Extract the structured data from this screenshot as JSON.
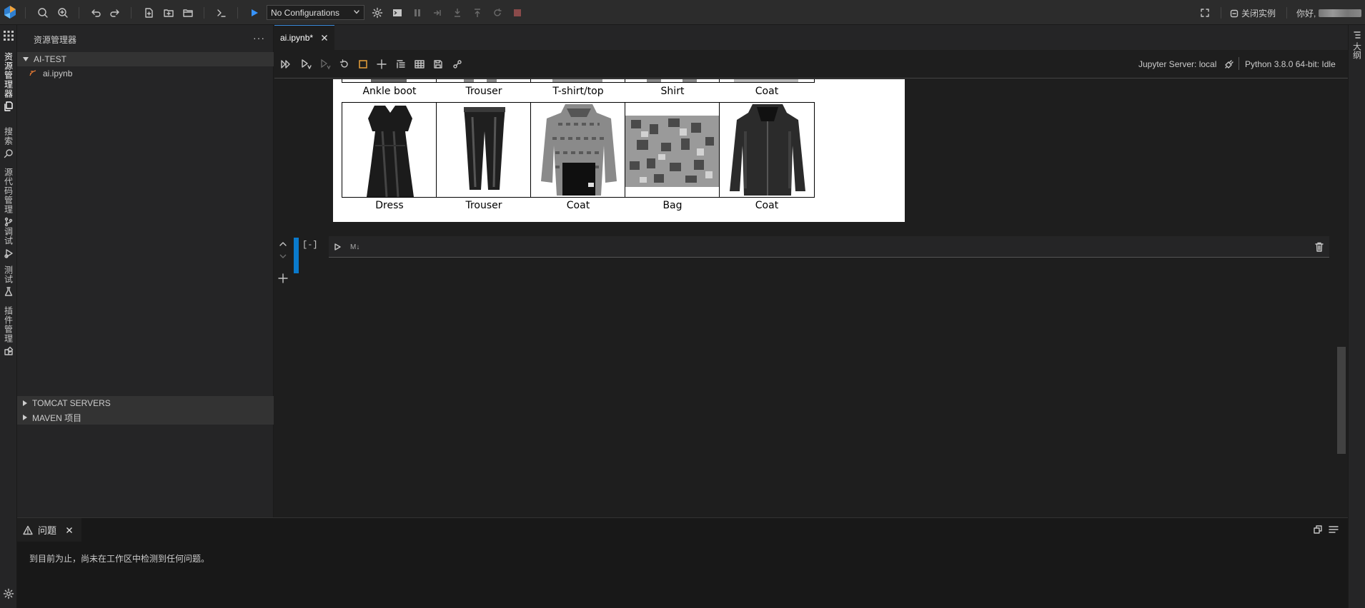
{
  "topbar": {
    "config_label": "No Configurations",
    "close_instance_label": "关闭实例",
    "greeting": "你好,"
  },
  "activity": {
    "explorer": "资源管理器",
    "search": "搜索",
    "source_control": "源代码管理",
    "debug": "调试",
    "test": "测试",
    "extensions": "插件管理"
  },
  "right_strip": {
    "outline": "大纲"
  },
  "sidebar": {
    "title": "资源管理器",
    "more": "···",
    "folder": "AI-TEST",
    "file": "ai.ipynb",
    "tomcat": "TOMCAT SERVERS",
    "maven": "MAVEN 项目"
  },
  "editor": {
    "tab_label": "ai.ipynb*",
    "jupyter_server": "Jupyter Server: local",
    "kernel": "Python 3.8.0 64-bit: Idle",
    "top_row_labels": [
      "Ankle boot",
      "Trouser",
      "T-shirt/top",
      "Shirt",
      "Coat"
    ],
    "bottom_row_labels": [
      "Dress",
      "Trouser",
      "Coat",
      "Bag",
      "Coat"
    ],
    "cell_count": "[-]",
    "cell_lang": "M↓"
  },
  "panel": {
    "tab_label": "问题",
    "message": "到目前为止，尚未在工作区中检测到任何问题。"
  },
  "colors": {
    "accent": "#0a7acc",
    "run": "#3794ff"
  }
}
